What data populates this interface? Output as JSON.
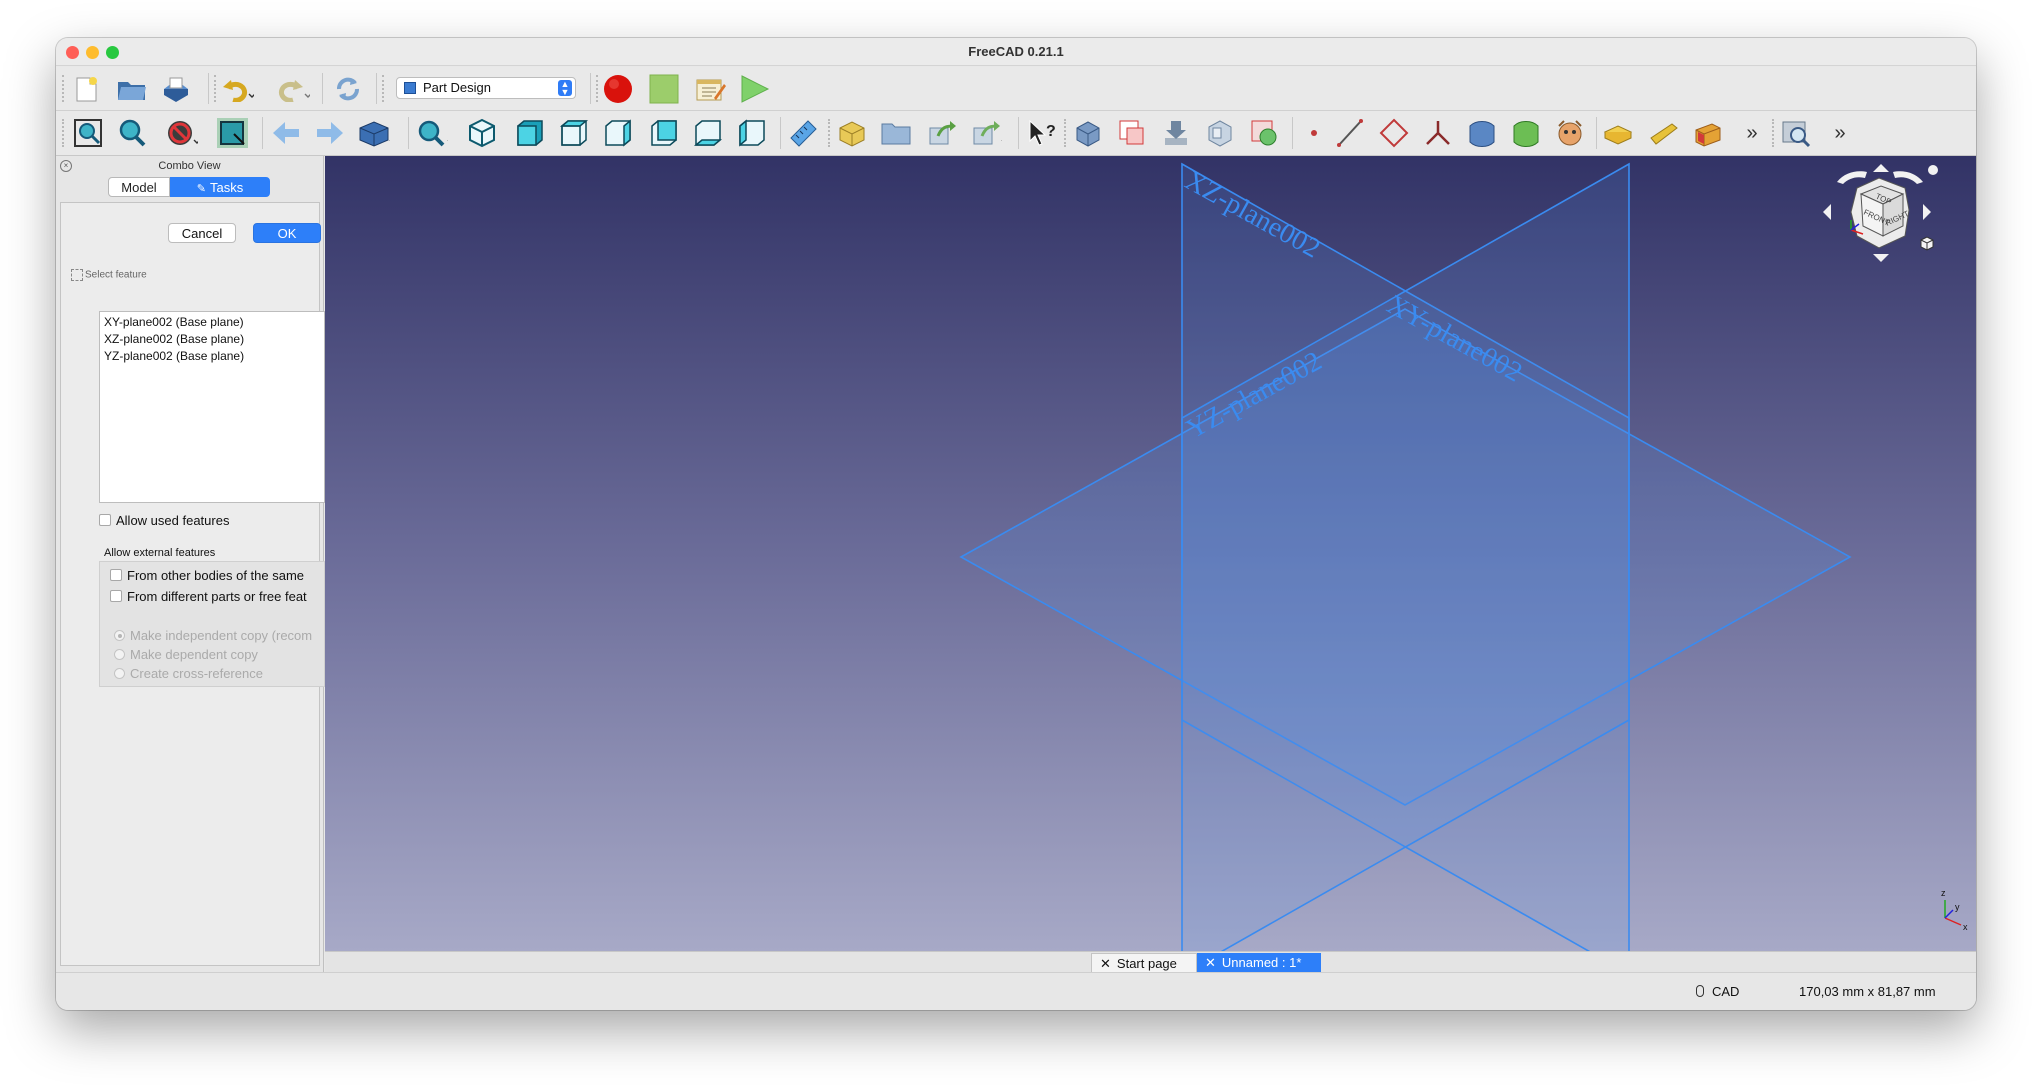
{
  "window": {
    "title": "FreeCAD 0.21.1"
  },
  "toolbar": {
    "workbench": "Part Design",
    "overflow_label": "»"
  },
  "combo_view": {
    "title": "Combo View",
    "tabs": {
      "model": "Model",
      "tasks": "Tasks"
    },
    "buttons": {
      "cancel": "Cancel",
      "ok": "OK"
    },
    "select_feature_label": "Select feature",
    "features": [
      "XY-plane002 (Base plane)",
      "XZ-plane002 (Base plane)",
      "YZ-plane002 (Base plane)"
    ],
    "allow_used_features": "Allow used features",
    "allow_external_label": "Allow external features",
    "external_options": [
      "From other bodies of the same",
      "From different parts or free feat"
    ],
    "copy_options": [
      "Make independent copy (recom",
      "Make dependent copy",
      "Create cross-reference"
    ],
    "selected_copy_option_index": 0
  },
  "viewport": {
    "plane_labels": {
      "xz": "XZ-plane002",
      "xy": "XY-plane002",
      "yz": "YZ-plane002"
    },
    "navcube_faces": {
      "top": "TOP",
      "front": "FRONT",
      "right": "RIGHT"
    },
    "axis_labels": {
      "x": "x",
      "y": "y",
      "z": "z"
    },
    "plane_color": "#3a8bf0"
  },
  "doc_tabs": [
    {
      "label": "Start page",
      "active": false
    },
    {
      "label": "Unnamed : 1*",
      "active": true
    }
  ],
  "status_bar": {
    "nav_style": "CAD",
    "dimensions": "170,03 mm x 81,87 mm"
  }
}
